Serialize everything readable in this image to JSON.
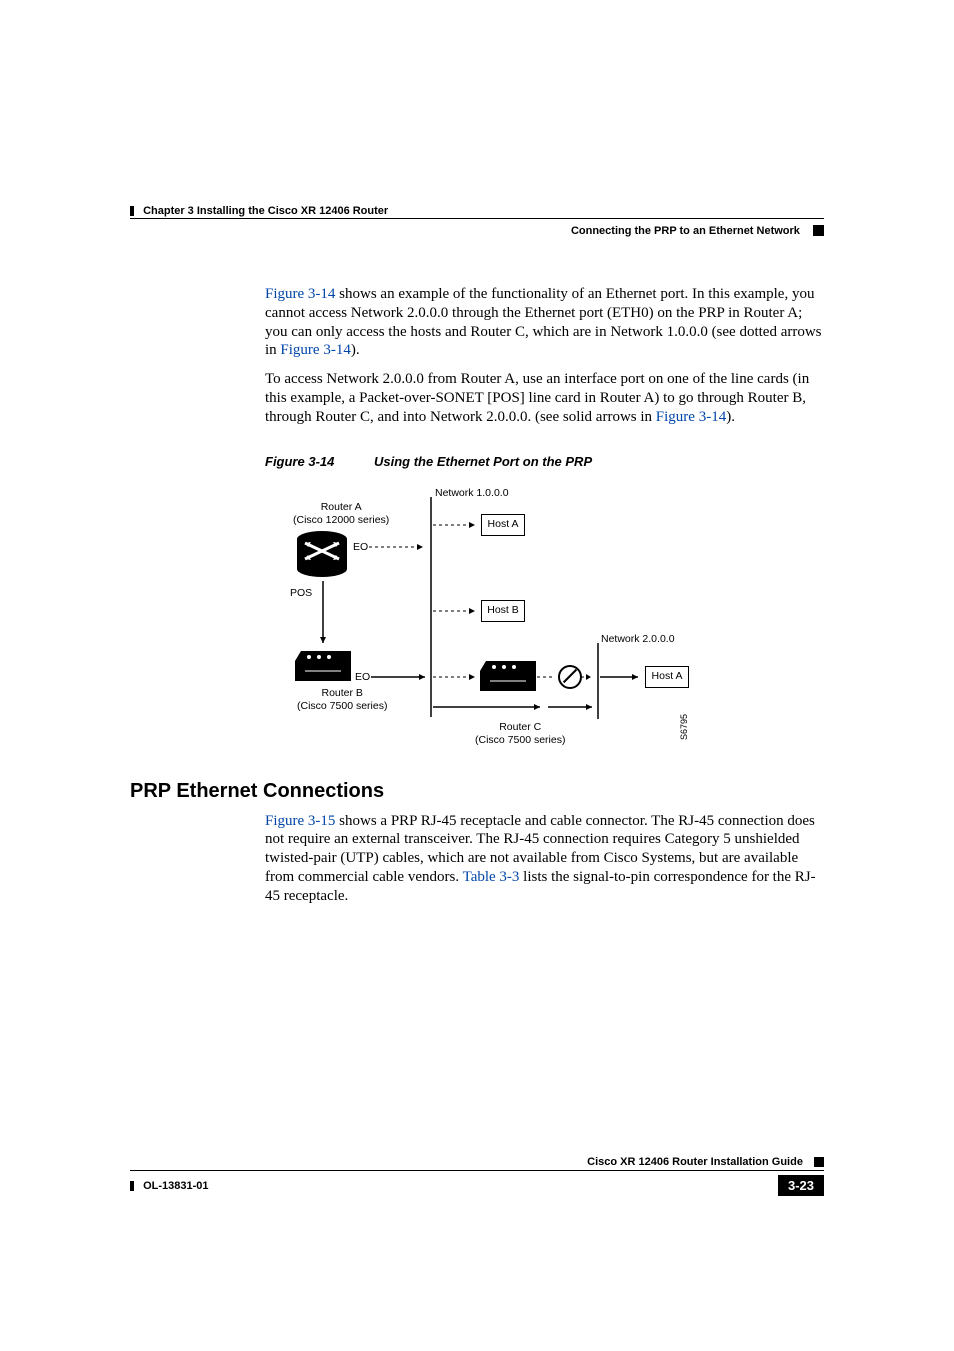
{
  "header": {
    "chapter": "Chapter 3      Installing the Cisco XR 12406 Router",
    "section": "Connecting the PRP to an Ethernet Network"
  },
  "paragraphs": {
    "p1a": "Figure 3-14",
    "p1b": " shows an example of the functionality of an Ethernet port. In this example, you cannot access Network 2.0.0.0 through the Ethernet port (ETH0) on the PRP in Router A; you can only access the hosts and Router C, which are in Network 1.0.0.0 (see dotted arrows in ",
    "p1c": "Figure 3-14",
    "p1d": ").",
    "p2a": "To access Network 2.0.0.0 from Router A, use an interface port on one of the line cards (in this example, a Packet-over-SONET [POS] line card in Router A) to go through Router B, through Router C, and into Network 2.0.0.0. (see solid arrows in ",
    "p2b": "Figure 3-14",
    "p2c": ")."
  },
  "figure": {
    "num": "Figure 3-14",
    "title": "Using the Ethernet Port on the PRP",
    "labels": {
      "routerA": "Router A",
      "routerA_sub": "(Cisco 12000 series)",
      "routerB": "Router B",
      "routerB_sub": "(Cisco 7500 series)",
      "routerC": "Router C",
      "routerC_sub": "(Cisco 7500 series)",
      "net1": "Network 1.0.0.0",
      "net2": "Network 2.0.0.0",
      "hostA": "Host A",
      "hostB": "Host B",
      "hostA2": "Host A",
      "eo1": "EO",
      "eo2": "EO",
      "pos": "POS",
      "sideid": "S6795"
    }
  },
  "section2": {
    "title": "PRP Ethernet Connections",
    "p1a": "Figure 3-15",
    "p1b": " shows a PRP RJ-45 receptacle and cable connector. The RJ-45 connection does not require an external transceiver. The RJ-45 connection requires Category 5 unshielded twisted-pair (UTP) cables, which are not available from Cisco Systems, but are available from commercial cable vendors. ",
    "p1c": "Table 3-3",
    "p1d": " lists the signal-to-pin correspondence for the RJ-45 receptacle."
  },
  "footer": {
    "guide": "Cisco XR 12406 Router Installation Guide",
    "docnum": "OL-13831-01",
    "page": "3-23"
  }
}
